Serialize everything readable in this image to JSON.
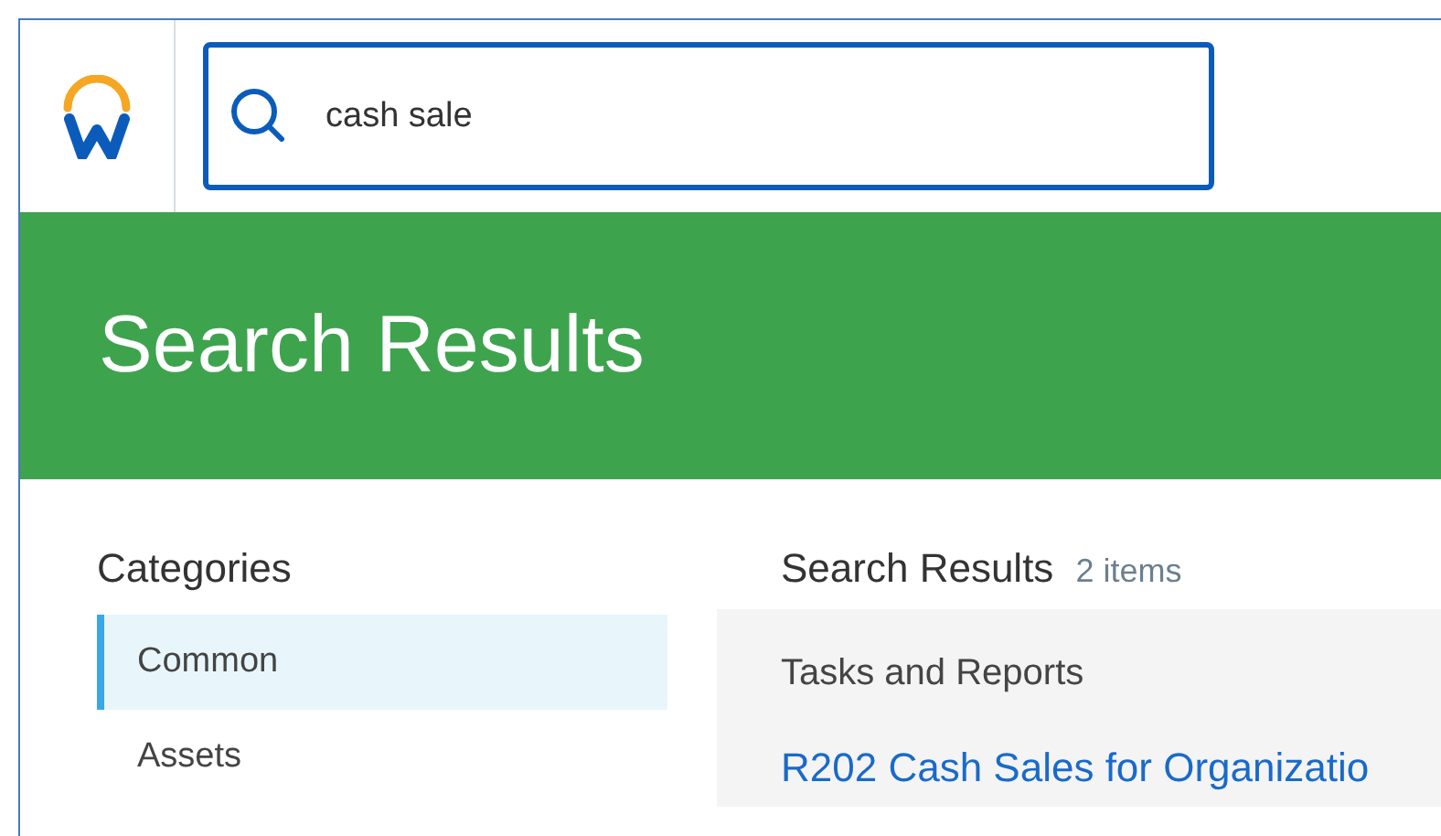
{
  "search": {
    "value": "cash sale"
  },
  "banner": {
    "title": "Search Results"
  },
  "categories": {
    "heading": "Categories",
    "items": [
      {
        "label": "Common",
        "selected": true
      },
      {
        "label": "Assets",
        "selected": false
      }
    ]
  },
  "results": {
    "heading": "Search Results",
    "count": "2 items",
    "section": "Tasks and Reports",
    "links": [
      "R202 Cash Sales for Organizatio"
    ]
  }
}
